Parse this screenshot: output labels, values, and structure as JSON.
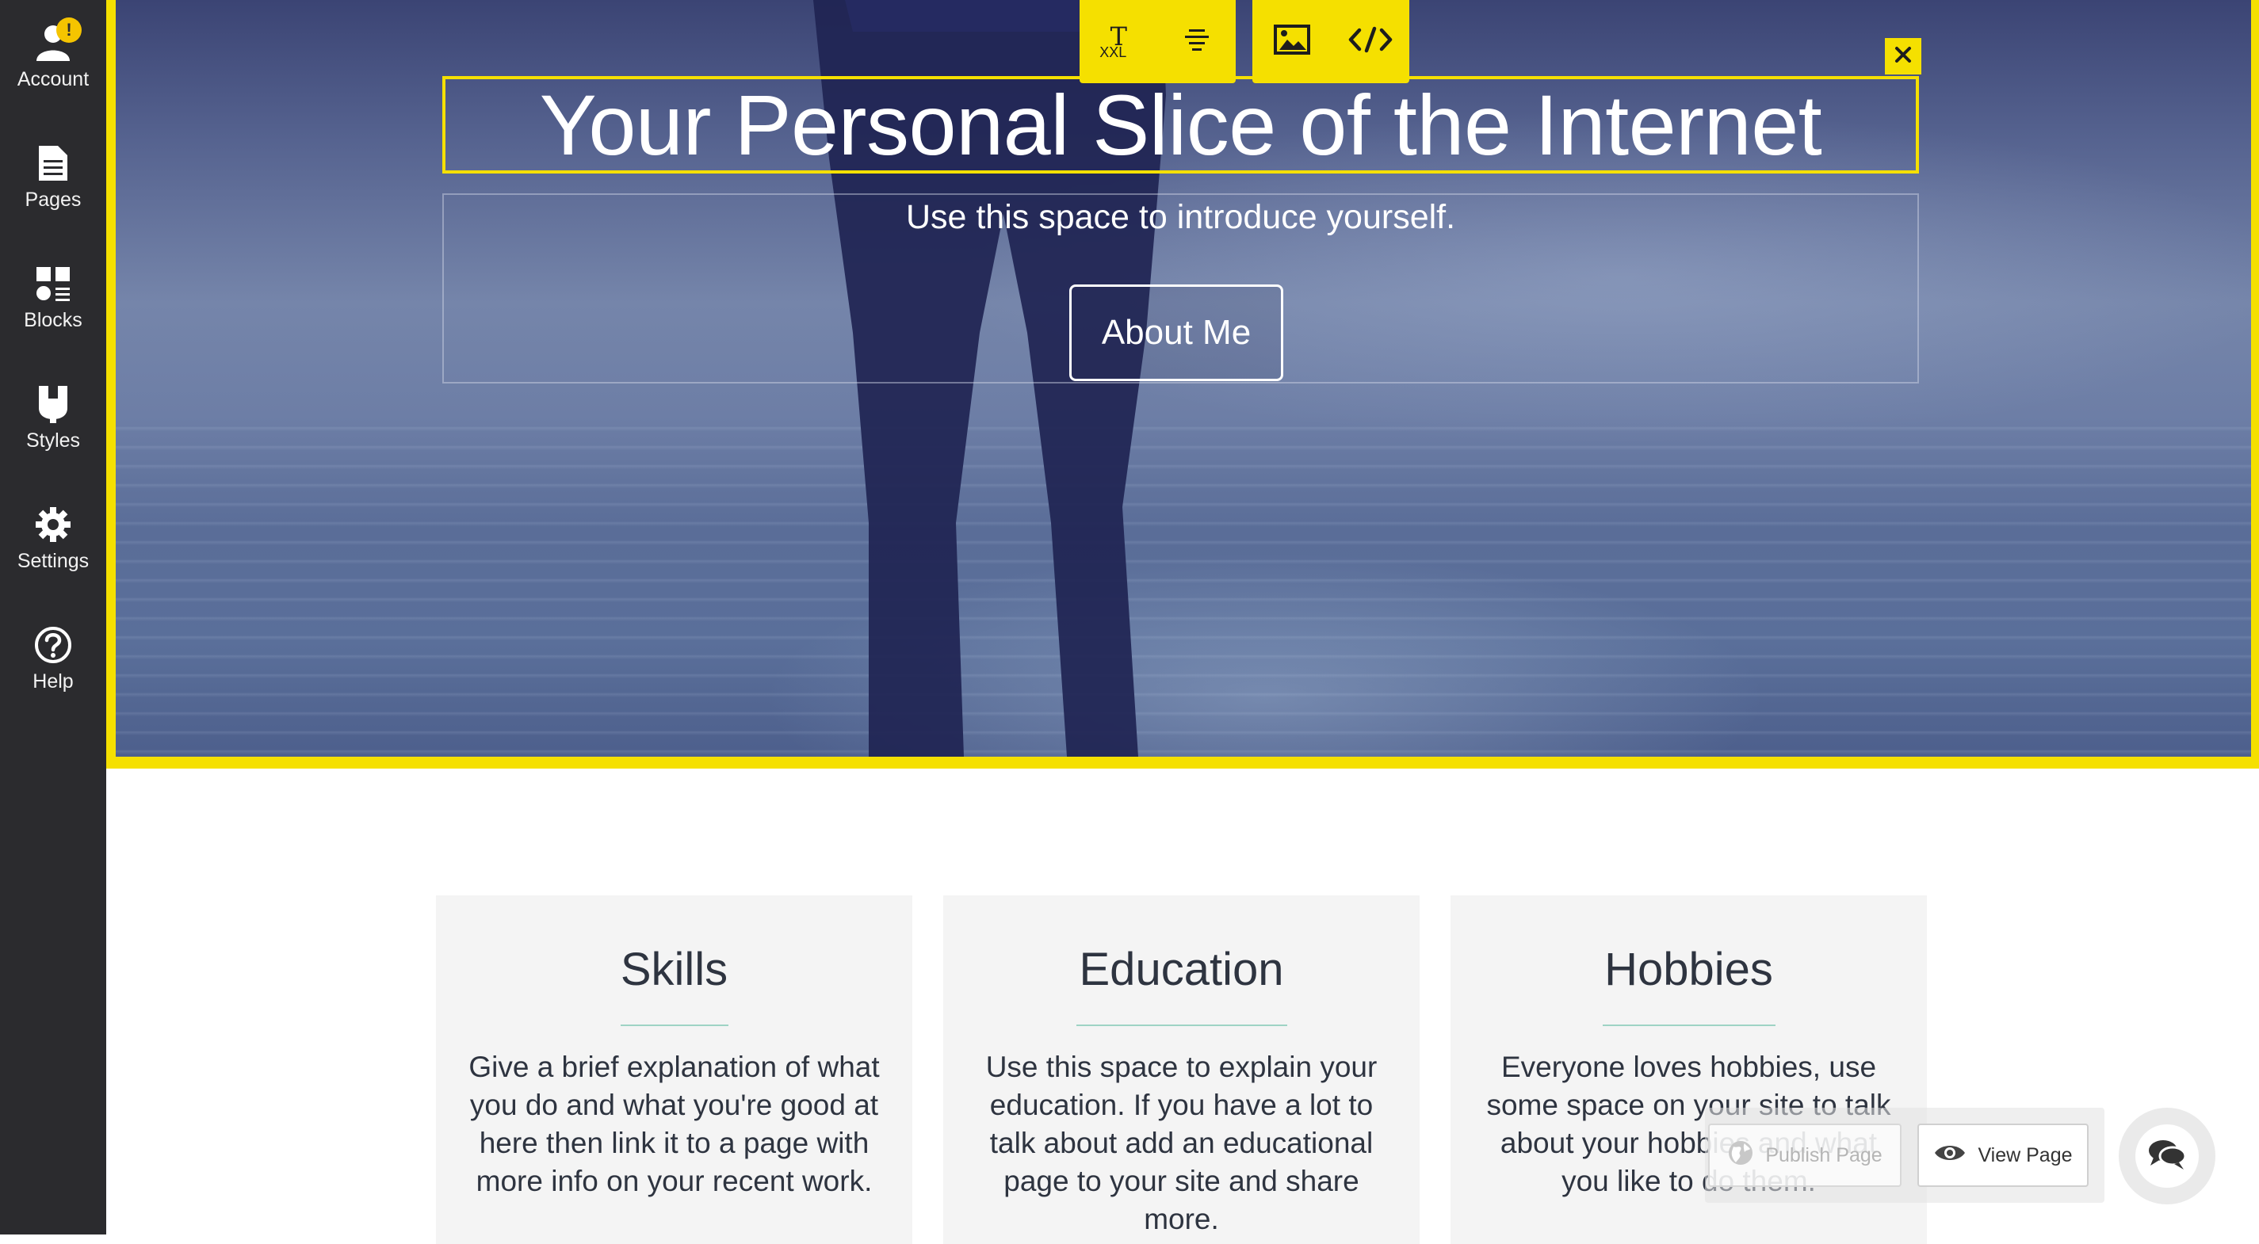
{
  "sidebar": {
    "items": [
      {
        "label": "Account",
        "icon": "user-icon",
        "badge": "!"
      },
      {
        "label": "Pages",
        "icon": "page-icon"
      },
      {
        "label": "Blocks",
        "icon": "blocks-icon"
      },
      {
        "label": "Styles",
        "icon": "styles-icon"
      },
      {
        "label": "Settings",
        "icon": "gear-icon"
      },
      {
        "label": "Help",
        "icon": "help-icon"
      }
    ]
  },
  "toolbar": {
    "text_size_glyph": "T",
    "text_size_value": "XXL",
    "align_icon": "align-center-icon",
    "image_icon": "image-icon",
    "code_icon": "code-icon",
    "close_icon": "close-icon"
  },
  "hero": {
    "title": "Your Personal Slice of the Internet",
    "subtitle": "Use this space to introduce yourself.",
    "button_label": "About Me"
  },
  "cards": [
    {
      "title": "Skills",
      "body": "Give a brief explanation of what you do and what you're good at here then link it to a page with more info on your recent work."
    },
    {
      "title": "Education",
      "body": "Use this space to explain your education. If you have a lot to talk about add an educational page to your site and share more."
    },
    {
      "title": "Hobbies",
      "body": "Everyone loves hobbies, use some space on your site to talk about your hobbies and what you like to do them."
    }
  ],
  "actions": {
    "publish_label": "Publish Page",
    "view_label": "View Page",
    "chat_icon": "chat-icon"
  },
  "colors": {
    "accent": "#f5e000",
    "sidebar_bg": "#2b2b2e",
    "card_bg": "#f4f4f4",
    "divider": "#9ed3c4"
  }
}
